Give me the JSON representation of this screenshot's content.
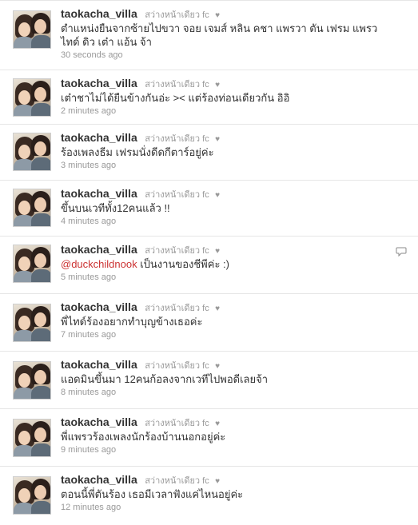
{
  "tweets": [
    {
      "username": "taokacha_villa",
      "display_name": "สว่างหน้าเดียว fc",
      "heart": "♥",
      "text_lines": [
        "ตำแหน่งยืนจากซ้ายไปขวา จอย เจมส์ หลิน คชา แพรวา ตัน เฟรม แพรว",
        "ไทด์ ดิว เต๋า แอ้น จ้า"
      ],
      "time": "30 seconds ago"
    },
    {
      "username": "taokacha_villa",
      "display_name": "สว่างหน้าเดียว fc",
      "heart": "♥",
      "text_lines": [
        "เต๋าชาไม่ได้ยืนข้างกันอ่ะ >< แต่ร้องท่อนเดียวกัน อิอิ"
      ],
      "time": "2 minutes ago"
    },
    {
      "username": "taokacha_villa",
      "display_name": "สว่างหน้าเดียว fc",
      "heart": "♥",
      "text_lines": [
        "ร้องเพลงธีม เฟรมนั่งดีดกีตาร์อยู่ค่ะ"
      ],
      "time": "3 minutes ago"
    },
    {
      "username": "taokacha_villa",
      "display_name": "สว่างหน้าเดียว fc",
      "heart": "♥",
      "text_lines": [
        "ขึ้นบนเวทีทั้ง12คนแล้ว !!"
      ],
      "time": "4 minutes ago"
    },
    {
      "username": "taokacha_villa",
      "display_name": "สว่างหน้าเดียว fc",
      "heart": "♥",
      "mention": "@duckchildnook",
      "text_lines": [
        " เป็นงานของชีพีค่ะ :)"
      ],
      "time": "5 minutes ago",
      "reply_icon": "speech-bubble-icon"
    },
    {
      "username": "taokacha_villa",
      "display_name": "สว่างหน้าเดียว fc",
      "heart": "♥",
      "text_lines": [
        "พี่ไทด์ร้องอยากทำบุญข้างเธอค่ะ"
      ],
      "time": "7 minutes ago"
    },
    {
      "username": "taokacha_villa",
      "display_name": "สว่างหน้าเดียว fc",
      "heart": "♥",
      "text_lines": [
        "แอดมินขึ้นมา 12คนก้อลงจากเวทีไปพอดีเลยจ้า"
      ],
      "time": "8 minutes ago"
    },
    {
      "username": "taokacha_villa",
      "display_name": "สว่างหน้าเดียว fc",
      "heart": "♥",
      "text_lines": [
        "พี่แพรวร้องเพลงนักร้องบ้านนอกอยู่ค่ะ"
      ],
      "time": "9 minutes ago"
    },
    {
      "username": "taokacha_villa",
      "display_name": "สว่างหน้าเดียว fc",
      "heart": "♥",
      "text_lines": [
        "ตอนนี้พี่ตันร้อง เธอมีเวลาฟังแค่ไหนอยู่ค่ะ"
      ],
      "time": "12 minutes ago"
    }
  ],
  "colors": {
    "username": "#333333",
    "meta": "#999999",
    "mention": "#cc3333",
    "border": "#e6e6e6"
  }
}
